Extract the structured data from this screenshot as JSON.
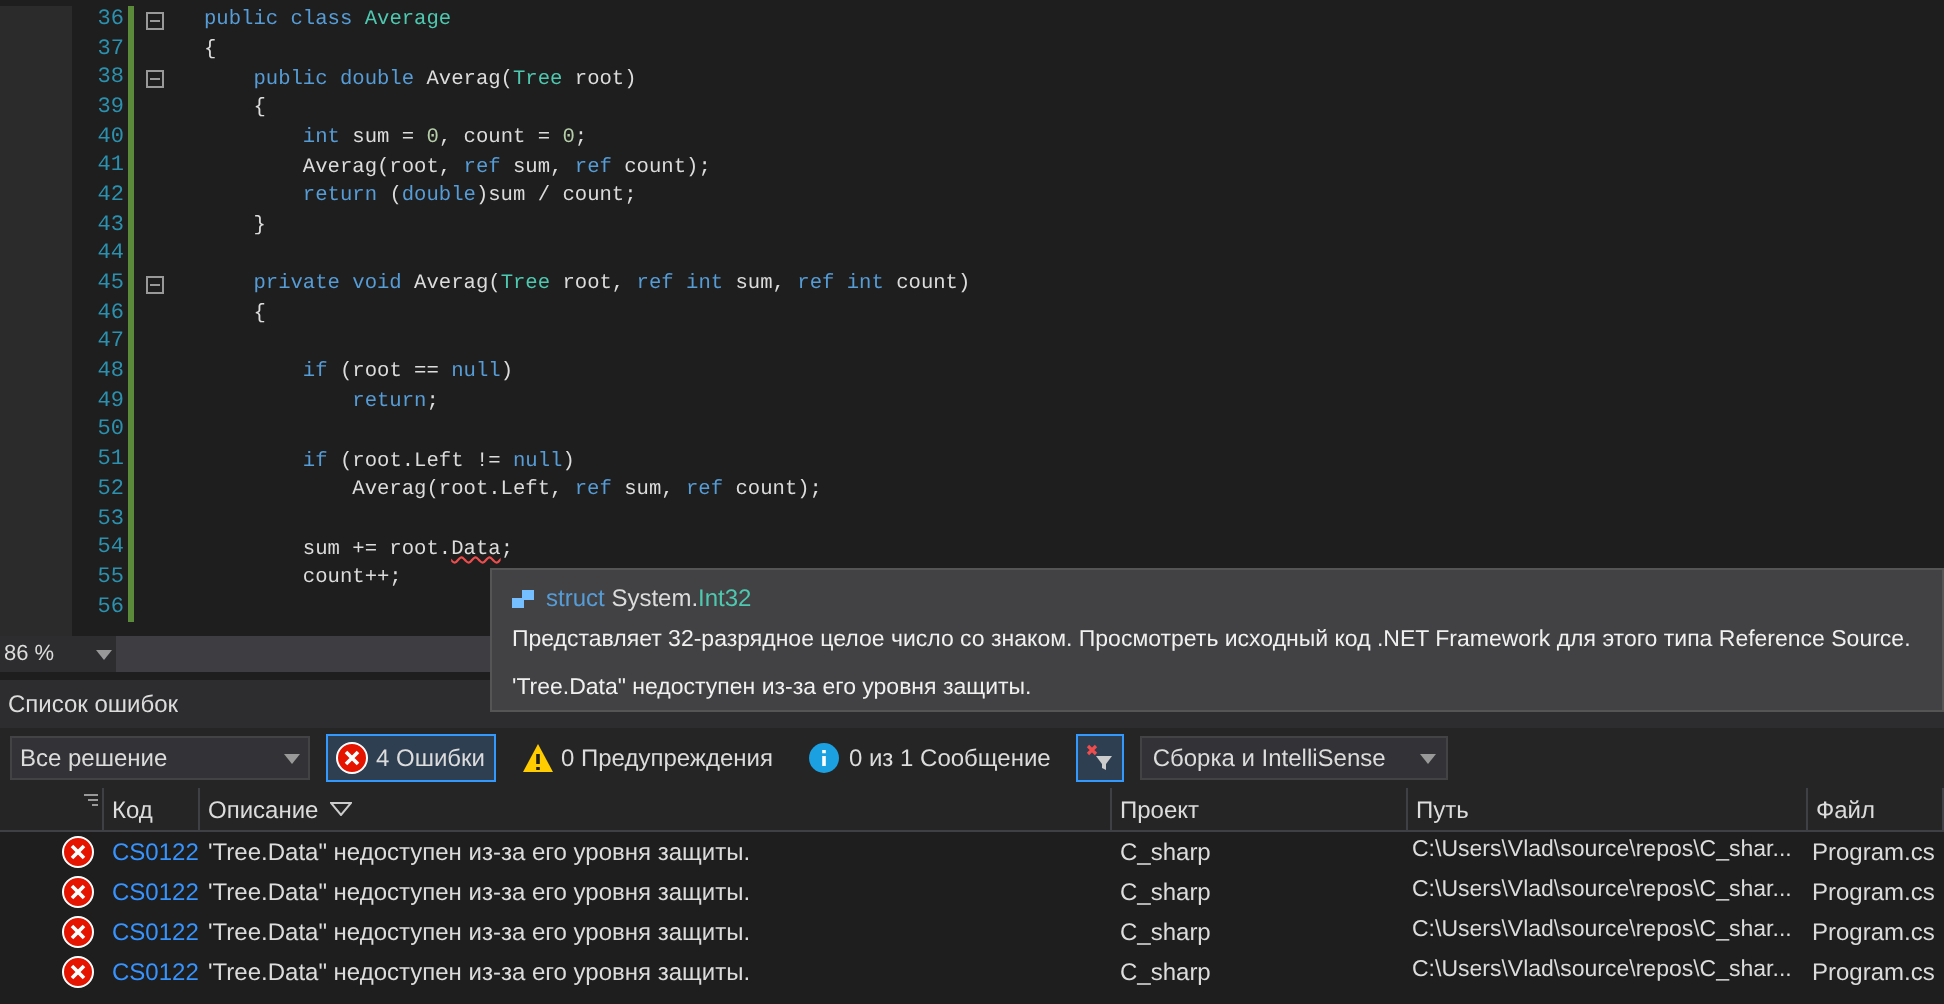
{
  "editor": {
    "lines": [
      {
        "number": "36",
        "fold": true,
        "tokens": [
          {
            "text": "public class ",
            "kind": "keyword"
          },
          {
            "text": "Average",
            "kind": "type"
          }
        ]
      },
      {
        "number": "37",
        "fold": false,
        "tokens": [
          {
            "text": "{",
            "kind": "plain"
          }
        ]
      },
      {
        "number": "38",
        "fold": true,
        "tokens": [
          {
            "text": "    public double ",
            "kind": "keyword"
          },
          {
            "text": "Averag(",
            "kind": "plain"
          },
          {
            "text": "Tree",
            "kind": "type"
          },
          {
            "text": " root)",
            "kind": "plain"
          }
        ]
      },
      {
        "number": "39",
        "fold": false,
        "tokens": [
          {
            "text": "    {",
            "kind": "plain"
          }
        ]
      },
      {
        "number": "40",
        "fold": false,
        "tokens": [
          {
            "text": "        int",
            "kind": "keyword"
          },
          {
            "text": " sum = ",
            "kind": "plain"
          },
          {
            "text": "0",
            "kind": "number"
          },
          {
            "text": ", count = ",
            "kind": "plain"
          },
          {
            "text": "0",
            "kind": "number"
          },
          {
            "text": ";",
            "kind": "plain"
          }
        ]
      },
      {
        "number": "41",
        "fold": false,
        "tokens": [
          {
            "text": "        Averag(root, ",
            "kind": "plain"
          },
          {
            "text": "ref",
            "kind": "keyword"
          },
          {
            "text": " sum, ",
            "kind": "plain"
          },
          {
            "text": "ref",
            "kind": "keyword"
          },
          {
            "text": " count);",
            "kind": "plain"
          }
        ]
      },
      {
        "number": "42",
        "fold": false,
        "tokens": [
          {
            "text": "        return",
            "kind": "keyword"
          },
          {
            "text": " (",
            "kind": "plain"
          },
          {
            "text": "double",
            "kind": "keyword"
          },
          {
            "text": ")sum / count;",
            "kind": "plain"
          }
        ]
      },
      {
        "number": "43",
        "fold": false,
        "tokens": [
          {
            "text": "    }",
            "kind": "plain"
          }
        ]
      },
      {
        "number": "44",
        "fold": false
      },
      {
        "number": "45",
        "fold": true,
        "tokens": [
          {
            "text": "    private void ",
            "kind": "keyword"
          },
          {
            "text": "Averag(",
            "kind": "plain"
          },
          {
            "text": "Tree",
            "kind": "type"
          },
          {
            "text": " root, ",
            "kind": "plain"
          },
          {
            "text": "ref int",
            "kind": "keyword"
          },
          {
            "text": " sum, ",
            "kind": "plain"
          },
          {
            "text": "ref int",
            "kind": "keyword"
          },
          {
            "text": " count)",
            "kind": "plain"
          }
        ]
      },
      {
        "number": "46",
        "fold": false,
        "tokens": [
          {
            "text": "    {",
            "kind": "plain"
          }
        ]
      },
      {
        "number": "47",
        "fold": false
      },
      {
        "number": "48",
        "fold": false,
        "tokens": [
          {
            "text": "        if",
            "kind": "keyword"
          },
          {
            "text": " (root == ",
            "kind": "plain"
          },
          {
            "text": "null",
            "kind": "keyword"
          },
          {
            "text": ")",
            "kind": "plain"
          }
        ]
      },
      {
        "number": "49",
        "fold": false,
        "tokens": [
          {
            "text": "            return",
            "kind": "keyword"
          },
          {
            "text": ";",
            "kind": "plain"
          }
        ]
      },
      {
        "number": "50",
        "fold": false
      },
      {
        "number": "51",
        "fold": false,
        "tokens": [
          {
            "text": "        if",
            "kind": "keyword"
          },
          {
            "text": " (root.Left != ",
            "kind": "plain"
          },
          {
            "text": "null",
            "kind": "keyword"
          },
          {
            "text": ")",
            "kind": "plain"
          }
        ]
      },
      {
        "number": "52",
        "fold": false,
        "tokens": [
          {
            "text": "            Averag(root.Left, ",
            "kind": "plain"
          },
          {
            "text": "ref",
            "kind": "keyword"
          },
          {
            "text": " sum, ",
            "kind": "plain"
          },
          {
            "text": "ref",
            "kind": "keyword"
          },
          {
            "text": " count);",
            "kind": "plain"
          }
        ]
      },
      {
        "number": "53",
        "fold": false
      },
      {
        "number": "54",
        "fold": false,
        "tokens": [
          {
            "text": "        sum += root.",
            "kind": "plain"
          },
          {
            "text": "Data",
            "kind": "error"
          },
          {
            "text": ";",
            "kind": "plain"
          }
        ]
      },
      {
        "number": "55",
        "fold": false,
        "tokens": [
          {
            "text": "        count++;",
            "kind": "plain"
          }
        ]
      },
      {
        "number": "56",
        "fold": false
      }
    ],
    "zoom": "86 %"
  },
  "tooltip": {
    "keyword": "struct",
    "namespace": "System.",
    "type": "Int32",
    "description": "Представляет 32-разрядное целое число со знаком. Просмотреть исходный код .NET Framework для этого типа Reference Source.",
    "error": "'Tree.Data\" недоступен из-за его уровня защиты."
  },
  "error_list": {
    "title": "Список ошибок",
    "scope": "Все решение",
    "filters": [
      {
        "kind": "error",
        "label": "4 Ошибки",
        "selected": true
      },
      {
        "kind": "warning",
        "label": "0 Предупреждения",
        "selected": false
      },
      {
        "kind": "info",
        "label": "0 из 1 Сообщение",
        "selected": false
      }
    ],
    "clear_filter": {
      "selected": true
    },
    "source": "Сборка и IntelliSense",
    "columns": [
      "Код",
      "Описание",
      "Проект",
      "Путь",
      "Файл"
    ],
    "rows": [
      {
        "code": "CS0122",
        "description": "'Tree.Data\" недоступен из-за его уровня защиты.",
        "project": "C_sharp",
        "path": "C:\\Users\\Vlad\\source\\repos\\C_shar...",
        "file": "Program.cs"
      },
      {
        "code": "CS0122",
        "description": "'Tree.Data\" недоступен из-за его уровня защиты.",
        "project": "C_sharp",
        "path": "C:\\Users\\Vlad\\source\\repos\\C_shar...",
        "file": "Program.cs"
      },
      {
        "code": "CS0122",
        "description": "'Tree.Data\" недоступен из-за его уровня защиты.",
        "project": "C_sharp",
        "path": "C:\\Users\\Vlad\\source\\repos\\C_shar...",
        "file": "Program.cs"
      },
      {
        "code": "CS0122",
        "description": "'Tree.Data\" недоступен из-за его уровня защиты.",
        "project": "C_sharp",
        "path": "C:\\Users\\Vlad\\source\\repos\\C_shar...",
        "file": "Program.cs"
      }
    ]
  }
}
